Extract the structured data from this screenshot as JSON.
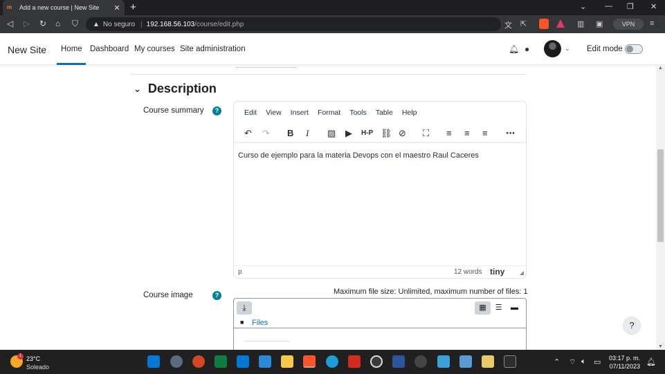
{
  "browser": {
    "tab_title": "Add a new course | New Site",
    "tab_icon": "m",
    "address_insecure": "No seguro",
    "address_host": "192.168.56.103",
    "address_path": "/course/edit.php",
    "vpn_label": "VPN"
  },
  "navbar": {
    "site_name": "New Site",
    "links": [
      "Home",
      "Dashboard",
      "My courses",
      "Site administration"
    ],
    "edit_mode_label": "Edit mode"
  },
  "section": {
    "title": "Description"
  },
  "course_summary": {
    "label": "Course summary",
    "help": "?",
    "menu": [
      "Edit",
      "View",
      "Insert",
      "Format",
      "Tools",
      "Table",
      "Help"
    ],
    "content": "Curso de ejemplo para la materia Devops con el maestro Raul Caceres",
    "status_path": "p",
    "word_count": "12 words",
    "tiny_brand": "tiny"
  },
  "course_image": {
    "label": "Course image",
    "help": "?",
    "max_size": "Maximum file size: Unlimited, maximum number of files: 1",
    "files_link": "Files"
  },
  "help_fab": "?",
  "taskbar": {
    "temperature": "23°C",
    "condition": "Soleado",
    "weather_badge": "1",
    "time": "03:17 p. m.",
    "date": "07/11/2023"
  }
}
